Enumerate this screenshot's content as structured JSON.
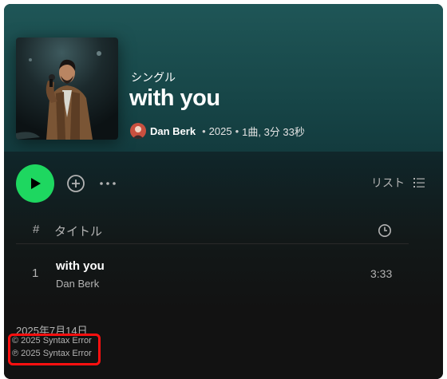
{
  "album": {
    "type_label": "シングル",
    "title": "with you",
    "artist": "Dan Berk",
    "year": "2025",
    "track_summary": "1曲, 3分 33秒",
    "separator": "•"
  },
  "actions": {
    "list_view_label": "リスト"
  },
  "table": {
    "num_header": "#",
    "title_header": "タイトル",
    "tracks": [
      {
        "number": "1",
        "title": "with you",
        "artist": "Dan Berk",
        "duration": "3:33"
      }
    ]
  },
  "footer": {
    "release_date": "2025年7月14日",
    "copyright": "© 2025 Syntax Error",
    "phonographic": "℗ 2025 Syntax Error"
  },
  "colors": {
    "accent": "#1ed760",
    "header_bg": "#1f5657",
    "highlight_box": "#ff1010"
  }
}
